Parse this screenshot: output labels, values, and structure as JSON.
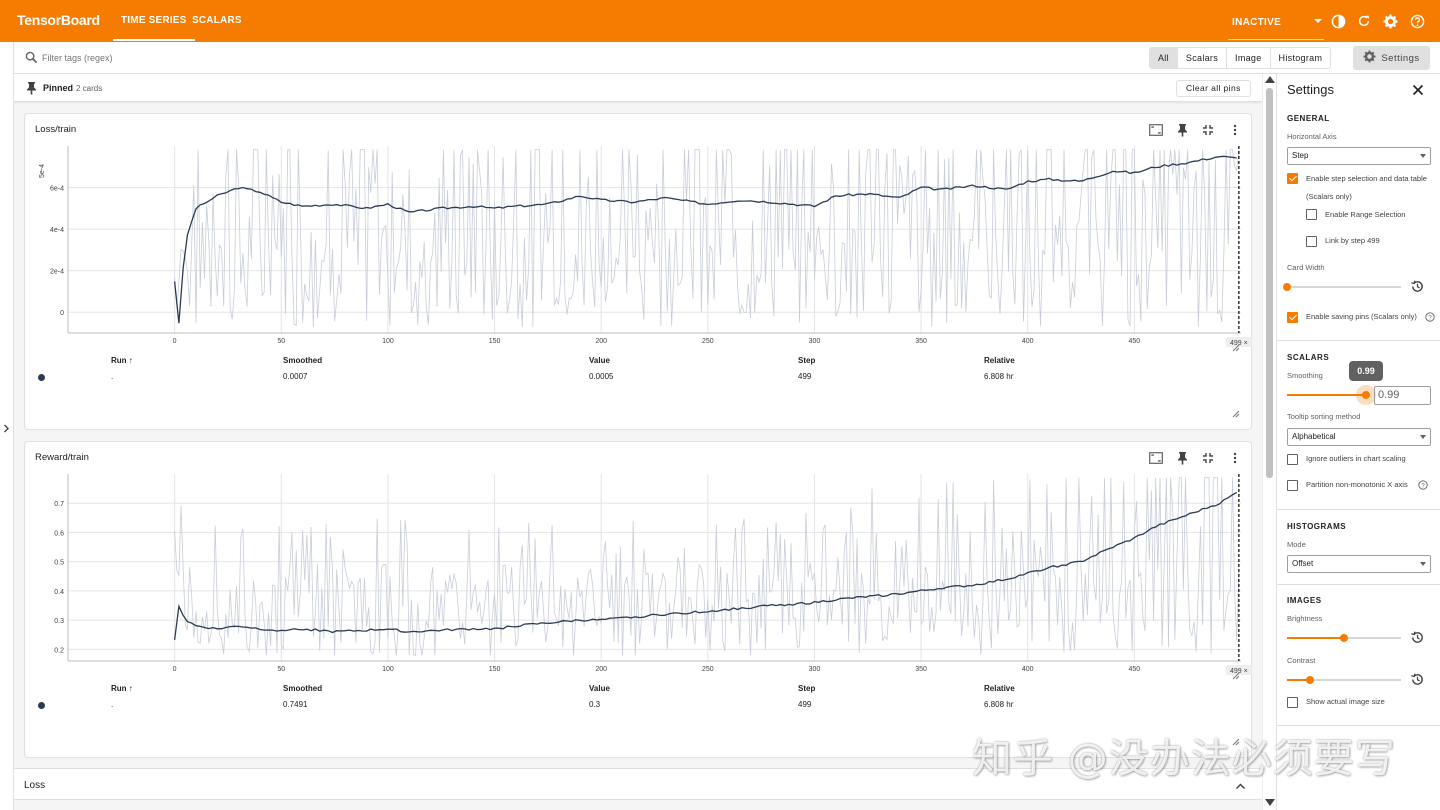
{
  "app": {
    "brand": "TensorBoard",
    "run_state": "INACTIVE"
  },
  "nav": {
    "tabs": [
      {
        "label": "TIME SERIES"
      },
      {
        "label": "SCALARS"
      }
    ]
  },
  "filter": {
    "placeholder": "Filter tags (regex)"
  },
  "type_filters": [
    "All",
    "Scalars",
    "Image",
    "Histogram"
  ],
  "settings_button": "Settings",
  "pinned": {
    "title": "Pinned",
    "count": "2 cards",
    "clear_label": "Clear all pins"
  },
  "cards": [
    {
      "title": "Loss/train",
      "columns": {
        "run": "Run ↑",
        "smoothed": "Smoothed",
        "value": "Value",
        "step": "Step",
        "relative": "Relative"
      },
      "row": {
        "run": ".",
        "smoothed": "0.0007",
        "value": "0.0005",
        "step": "499",
        "relative": "6.808 hr"
      },
      "step_marker": "499 ×"
    },
    {
      "title": "Reward/train",
      "columns": {
        "run": "Run ↑",
        "smoothed": "Smoothed",
        "value": "Value",
        "step": "Step",
        "relative": "Relative"
      },
      "row": {
        "run": ".",
        "smoothed": "0.7491",
        "value": "0.3",
        "step": "499",
        "relative": "6.808 hr"
      },
      "step_marker": "499 ×"
    }
  ],
  "group": {
    "title": "Loss"
  },
  "settings": {
    "title": "Settings",
    "general": {
      "heading": "GENERAL",
      "horizontal_axis_label": "Horizontal Axis",
      "horizontal_axis_value": "Step",
      "step_selection": {
        "label_line1": "Enable step selection and data table",
        "label_line2": "(Scalars only)",
        "checked": true
      },
      "range_selection": {
        "label": "Enable Range Selection",
        "checked": false
      },
      "link_by_step": {
        "label": "Link by step 499",
        "checked": false
      },
      "card_width_label": "Card Width",
      "card_width_level": 0.0,
      "saving_pins": {
        "label": "Enable saving pins (Scalars only)",
        "checked": true
      }
    },
    "scalars": {
      "heading": "SCALARS",
      "smoothing_label": "Smoothing",
      "smoothing_value": "0.99",
      "smoothing_tooltip": "0.99",
      "tooltip_sort_label": "Tooltip sorting method",
      "tooltip_sort_value": "Alphabetical",
      "ignore_outliers": {
        "label": "Ignore outliers in chart scaling",
        "checked": false
      },
      "partition": {
        "label": "Partition non-monotonic X axis",
        "checked": false
      }
    },
    "histograms": {
      "heading": "HISTOGRAMS",
      "mode_label": "Mode",
      "mode_value": "Offset"
    },
    "images": {
      "heading": "IMAGES",
      "brightness_label": "Brightness",
      "brightness_level": 0.5,
      "contrast_label": "Contrast",
      "contrast_level": 0.2,
      "actual_size": {
        "label": "Show actual image size",
        "checked": false
      }
    }
  },
  "watermark": "知乎 @没办法必须要写",
  "colors": {
    "accent": "#f57c00",
    "smoothed_line": "#2b3a55",
    "raw_line": "#c8cdd8"
  },
  "chart_data": [
    {
      "type": "line",
      "title": "Loss/train",
      "x_ticks": [
        "0",
        "50",
        "100",
        "150",
        "200",
        "250",
        "300",
        "350",
        "400",
        "450"
      ],
      "y_ticks": [
        "0",
        "2e-4",
        "4e-4",
        "6e-4"
      ],
      "y_axis_exponent_label": "5e-4",
      "xlim": [
        -50,
        500
      ],
      "ylim": [
        -0.0001,
        0.0008
      ],
      "selected_step": 499,
      "series": [
        {
          "x": [
            0,
            2,
            5,
            10,
            20,
            30,
            40,
            50,
            60,
            75,
            90,
            100,
            110,
            125,
            140,
            150,
            160,
            175,
            190,
            200,
            215,
            230,
            250,
            265,
            280,
            300,
            310,
            325,
            340,
            350,
            360,
            375,
            390,
            400,
            410,
            425,
            440,
            450,
            460,
            475,
            490,
            499
          ],
          "y": [
            0.00015,
            -5e-05,
            0.00034,
            0.0005,
            0.00056,
            0.0006,
            0.00058,
            0.00053,
            0.00051,
            0.00052,
            0.0005,
            0.00052,
            0.00048,
            0.0005,
            0.00051,
            0.0005,
            0.00051,
            0.00052,
            0.00056,
            0.00054,
            0.00053,
            0.00055,
            0.00052,
            0.00054,
            0.00053,
            0.00051,
            0.00056,
            0.00057,
            0.00055,
            0.0006,
            0.00059,
            0.00061,
            0.00059,
            0.00063,
            0.00064,
            0.00063,
            0.00068,
            0.00067,
            0.0007,
            0.00072,
            0.00075,
            0.00074
          ]
        }
      ]
    },
    {
      "type": "line",
      "title": "Reward/train",
      "x_ticks": [
        "0",
        "50",
        "100",
        "150",
        "200",
        "250",
        "300",
        "350",
        "400",
        "450"
      ],
      "y_ticks": [
        "0.2",
        "0.3",
        "0.4",
        "0.5",
        "0.6",
        "0.7"
      ],
      "xlim": [
        -50,
        500
      ],
      "ylim": [
        0.16,
        0.8
      ],
      "selected_step": 499,
      "series": [
        {
          "x": [
            0,
            2,
            5,
            10,
            20,
            30,
            40,
            50,
            60,
            75,
            90,
            100,
            110,
            125,
            140,
            150,
            160,
            175,
            190,
            200,
            215,
            230,
            250,
            265,
            280,
            300,
            310,
            325,
            340,
            350,
            360,
            375,
            390,
            400,
            410,
            425,
            440,
            450,
            460,
            475,
            490,
            499
          ],
          "y": [
            0.23,
            0.35,
            0.3,
            0.28,
            0.27,
            0.28,
            0.27,
            0.265,
            0.27,
            0.26,
            0.265,
            0.27,
            0.26,
            0.265,
            0.27,
            0.27,
            0.28,
            0.29,
            0.3,
            0.3,
            0.31,
            0.32,
            0.33,
            0.34,
            0.35,
            0.36,
            0.37,
            0.38,
            0.39,
            0.4,
            0.41,
            0.42,
            0.44,
            0.46,
            0.48,
            0.5,
            0.55,
            0.58,
            0.62,
            0.66,
            0.7,
            0.74
          ]
        }
      ]
    }
  ]
}
